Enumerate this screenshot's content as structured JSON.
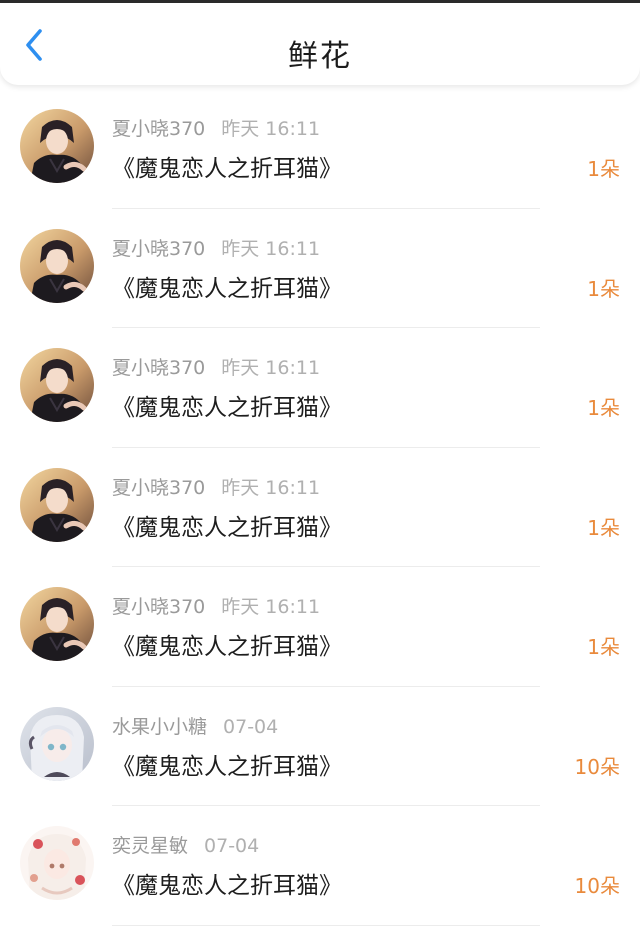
{
  "header": {
    "title": "鲜花",
    "back_icon": "chevron-left-icon",
    "accent_color": "#2e8ff0"
  },
  "rows": [
    {
      "user": "夏小晓370",
      "time": "昨天 16:11",
      "book": "《魔鬼恋人之折耳猫》",
      "count": "1朵",
      "avatar": "anime-boy"
    },
    {
      "user": "夏小晓370",
      "time": "昨天 16:11",
      "book": "《魔鬼恋人之折耳猫》",
      "count": "1朵",
      "avatar": "anime-boy"
    },
    {
      "user": "夏小晓370",
      "time": "昨天 16:11",
      "book": "《魔鬼恋人之折耳猫》",
      "count": "1朵",
      "avatar": "anime-boy"
    },
    {
      "user": "夏小晓370",
      "time": "昨天 16:11",
      "book": "《魔鬼恋人之折耳猫》",
      "count": "1朵",
      "avatar": "anime-boy"
    },
    {
      "user": "夏小晓370",
      "time": "昨天 16:11",
      "book": "《魔鬼恋人之折耳猫》",
      "count": "1朵",
      "avatar": "anime-boy"
    },
    {
      "user": "水果小小糖",
      "time": "07-04",
      "book": "《魔鬼恋人之折耳猫》",
      "count": "10朵",
      "avatar": "anime-girl-silver"
    },
    {
      "user": "奕灵星敏",
      "time": "07-04",
      "book": "《魔鬼恋人之折耳猫》",
      "count": "10朵",
      "avatar": "anime-girl-white"
    }
  ],
  "colors": {
    "count": "#e98a3c",
    "meta": "#9a9a9a",
    "book": "#1e1e1e"
  }
}
